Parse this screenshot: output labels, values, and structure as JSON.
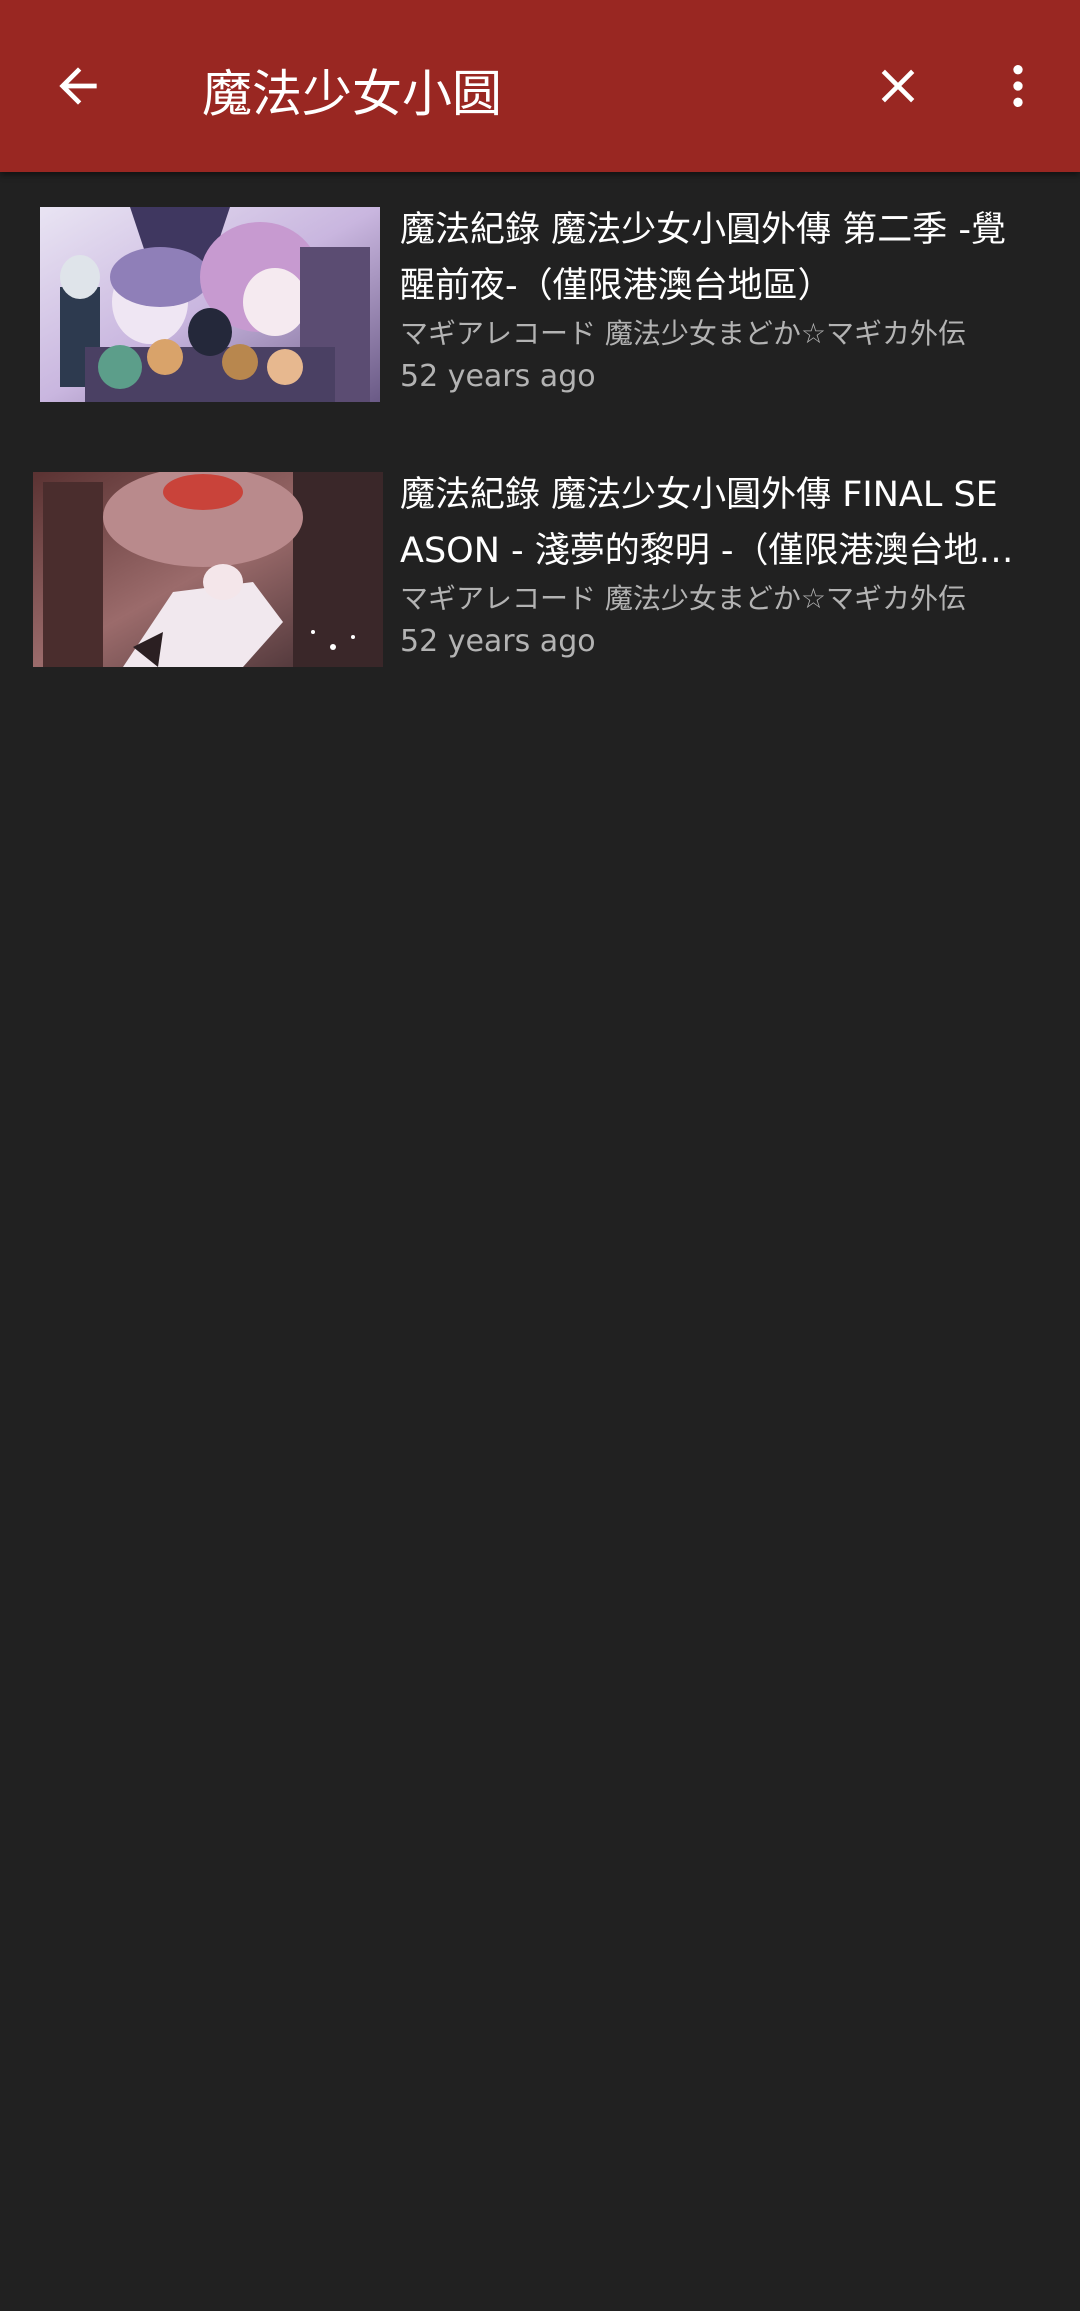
{
  "toolbar": {
    "search_value": "魔法少女小圆",
    "back_icon": "arrow-back-icon",
    "clear_icon": "close-icon",
    "more_icon": "more-vert-icon"
  },
  "colors": {
    "toolbar_bg": "#992722",
    "page_bg": "#212121",
    "title_text": "#ffffff",
    "meta_text": "#b3b3b3"
  },
  "results": [
    {
      "title": "魔法紀錄 魔法少女小圓外傳 第二季 -覺醒前夜-（僅限港澳台地區）",
      "channel": "マギアレコード 魔法少女まどか☆マギカ外伝",
      "date": "52 years ago"
    },
    {
      "title": "魔法紀錄 魔法少女小圓外傳 FINAL SEASON - 淺夢的黎明 -（僅限港澳台地區）",
      "channel": "マギアレコード 魔法少女まどか☆マギカ外伝",
      "date": "52 years ago"
    }
  ]
}
